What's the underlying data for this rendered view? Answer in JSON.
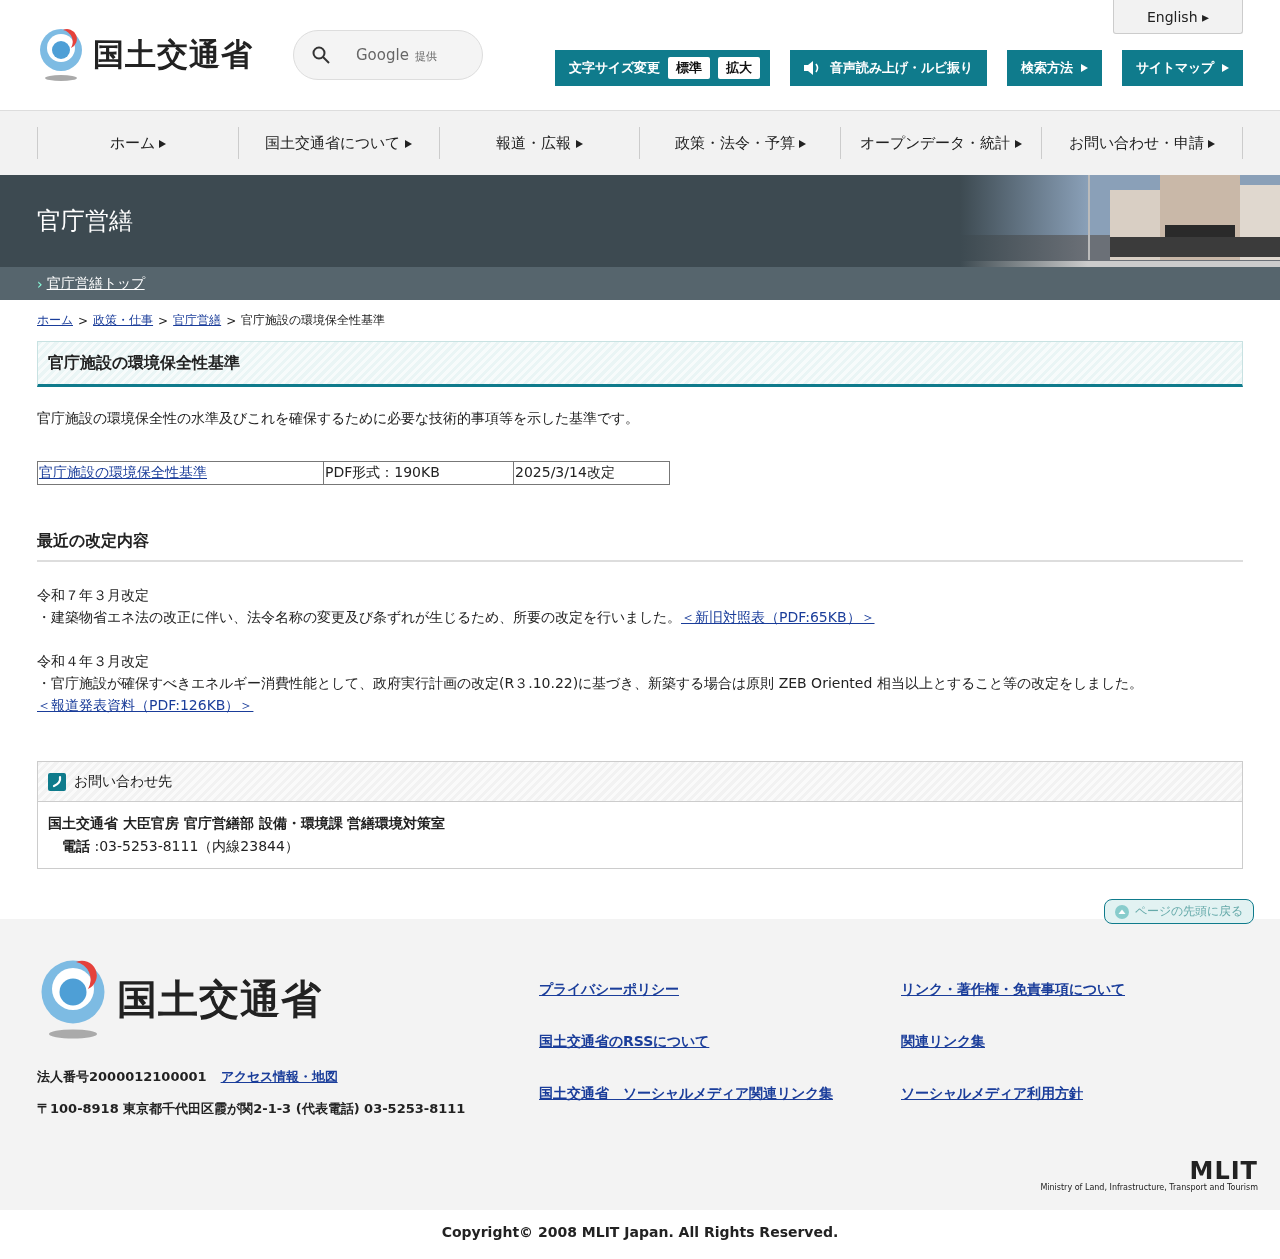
{
  "header": {
    "logo_text": "国土交通省",
    "search": {
      "placeholder": "Google",
      "provider_note": "提供"
    },
    "language_button": "English ▸",
    "font_size": {
      "label": "文字サイズ変更",
      "options": [
        "標準",
        "拡大"
      ]
    },
    "buttons": [
      {
        "kind": "speaker",
        "label": "音声読み上げ・ルビ振り"
      },
      {
        "kind": "arrow",
        "label": "検索方法"
      },
      {
        "kind": "arrow",
        "label": "サイトマップ"
      }
    ]
  },
  "nav": [
    "ホーム",
    "国土交通省について",
    "報道・広報",
    "政策・法令・予算",
    "オープンデータ・統計",
    "お問い合わせ・申請"
  ],
  "banner": {
    "title": "官庁営繕",
    "sub_link_marker": "›",
    "sub_link": "官庁営繕トップ"
  },
  "breadcrumb": {
    "links": [
      {
        "label": "ホーム",
        "separator": ">"
      },
      {
        "label": "政策・仕事",
        "separator": ">"
      },
      {
        "label": "官庁営繕",
        "separator": ">"
      }
    ],
    "current": "官庁施設の環境保全性基準"
  },
  "page_title": "官庁施設の環境保全性基準",
  "intro": "官庁施設の環境保全性の水準及びこれを確保するために必要な技術的事項等を示した基準です。",
  "file_table": {
    "link": "官庁施設の環境保全性基準",
    "format": "PDF形式：190KB",
    "date": "2025/3/14改定"
  },
  "revisions": {
    "heading": "最近の改定内容",
    "items": [
      {
        "date": "令和７年３月改定",
        "text": "・建築物省エネ法の改正に伴い、法令名称の変更及び条ずれが生じるため、所要の改定を行いました。",
        "link": "＜新旧対照表（PDF:65KB）＞"
      },
      {
        "date": "令和４年３月改定",
        "text": "・官庁施設が確保すべきエネルギー消費性能として、政府実行計画の改定(R３.10.22)に基づき、新築する場合は原則 ZEB Oriented 相当以上とすること等の改定をしました。",
        "link": "＜報道発表資料（PDF:126KB）＞"
      }
    ]
  },
  "contact": {
    "title": "お問い合わせ先",
    "department": "国土交通省 大臣官房 官庁営繕部 設備・環境課 営繕環境対策室",
    "phone": "**電話** :03-5253-8111（内線23844）"
  },
  "back_to_top": "ページの先頭に戻る",
  "footer": {
    "logo_text": "国土交通省",
    "corporate_number": "法人番号2000012100001",
    "access_link": "アクセス情報・地図",
    "address": "〒100-8918 東京都千代田区霞が関2-1-3 (代表電話) 03-5253-8111",
    "links": [
      "プライバシーポリシー",
      "リンク・著作権・免責事項について",
      "国土交通省のRSSについて",
      "関連リンク集",
      "国土交通省　ソーシャルメディア関連リンク集",
      "ソーシャルメディア利用方針"
    ],
    "mlit_logo": "MLIT",
    "mlit_caption": "Ministry of Land, Infrastructure, Transport and Tourism"
  },
  "copyright": "Copyright© 2008 MLIT Japan. All Rights Reserved."
}
